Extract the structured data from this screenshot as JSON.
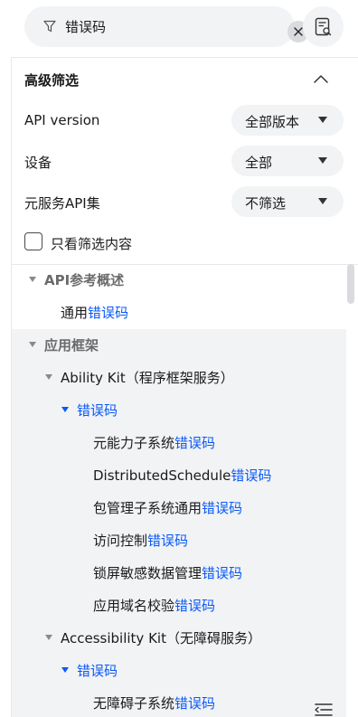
{
  "search": {
    "query": "错误码"
  },
  "advanced": {
    "title": "高级筛选",
    "filters": [
      {
        "label": "API version",
        "value": "全部版本"
      },
      {
        "label": "设备",
        "value": "全部"
      },
      {
        "label": "元服务API集",
        "value": "不筛选"
      }
    ],
    "only_filtered_label": "只看筛选内容"
  },
  "tree": {
    "api_ref": "API参考概述",
    "general_prefix": "通用",
    "app_framework": "应用框架",
    "ability_kit": "Ability Kit（程序框架服务）",
    "error_code": "错误码",
    "items": [
      {
        "prefix": "元能力子系统",
        "suffix": "错误码"
      },
      {
        "prefix": "DistributedSchedule",
        "suffix": "错误码"
      },
      {
        "prefix": "包管理子系统通用",
        "suffix": "错误码"
      },
      {
        "prefix": "访问控制",
        "suffix": "错误码"
      },
      {
        "prefix": "锁屏敏感数据管理",
        "suffix": "错误码"
      },
      {
        "prefix": "应用域名校验",
        "suffix": "错误码"
      }
    ],
    "accessibility_kit": "Accessibility Kit（无障碍服务）",
    "accessibility_items": [
      {
        "prefix": "无障碍子系统",
        "suffix": "错误码"
      }
    ]
  },
  "colors": {
    "highlight": "#0a59f7",
    "surface": "#f1f3f5"
  }
}
